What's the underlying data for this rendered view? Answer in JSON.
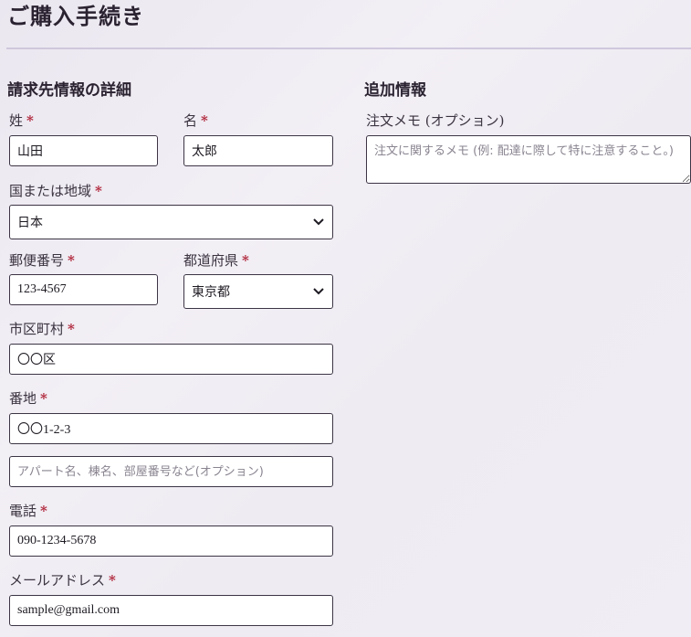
{
  "page": {
    "title": "ご購入手続き"
  },
  "billing": {
    "heading": "請求先情報の詳細",
    "required_mark": "*",
    "last_name": {
      "label": "姓",
      "value": "山田"
    },
    "first_name": {
      "label": "名",
      "value": "太郎"
    },
    "country": {
      "label": "国または地域",
      "value": "日本"
    },
    "postal_code": {
      "label": "郵便番号",
      "value": "123-4567"
    },
    "prefecture": {
      "label": "都道府県",
      "value": "東京都"
    },
    "city": {
      "label": "市区町村",
      "value": "〇〇区"
    },
    "address": {
      "label": "番地",
      "value": "〇〇1-2-3",
      "line2_placeholder": "アパート名、棟名、部屋番号など(オプション)"
    },
    "phone": {
      "label": "電話",
      "value": "090-1234-5678"
    },
    "email": {
      "label": "メールアドレス",
      "value": "sample@gmail.com"
    }
  },
  "additional": {
    "heading": "追加情報",
    "order_notes": {
      "label": "注文メモ (オプション)",
      "placeholder": "注文に関するメモ (例: 配達に際して特に注意すること。)"
    }
  },
  "icons": {
    "select_chevron": "chevron-down-icon"
  },
  "colors": {
    "required": "#b0263a",
    "border": "#3c3444",
    "rule": "#cfc8dc"
  }
}
